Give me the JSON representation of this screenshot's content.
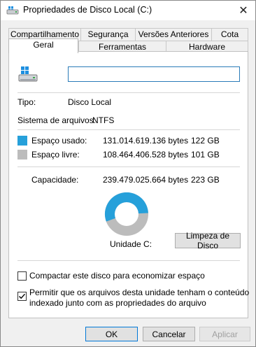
{
  "window": {
    "title": "Propriedades de Disco Local (C:)",
    "close_symbol": "✕"
  },
  "tabs_row1": [
    "Compartilhamento",
    "Segurança",
    "Versões Anteriores",
    "Cota"
  ],
  "tabs_row2": [
    "Geral",
    "Ferramentas",
    "Hardware"
  ],
  "active_tab": "Geral",
  "general": {
    "drive_icon": "drive-icon",
    "name_value": "",
    "type_label": "Tipo:",
    "type_value": "Disco Local",
    "fs_label": "Sistema de arquivos:",
    "fs_value": "NTFS",
    "used_label": "Espaço usado:",
    "used_bytes": "131.014.619.136 bytes",
    "used_gb": "122 GB",
    "free_label": "Espaço livre:",
    "free_bytes": "108.464.406.528 bytes",
    "free_gb": "101 GB",
    "capacity_label": "Capacidade:",
    "capacity_bytes": "239.479.025.664 bytes",
    "capacity_gb": "223 GB",
    "used_fraction": 0.547,
    "unit_label": "Unidade C:",
    "cleanup_button": "Limpeza de Disco",
    "compress_label": "Compactar este disco para economizar espaço",
    "compress_checked": false,
    "index_label_line1": "Permitir que os arquivos desta unidade tenham o conteúdo",
    "index_label_line2": "indexado junto com as propriedades do arquivo",
    "index_checked": true
  },
  "colors": {
    "used": "#26a0da",
    "free": "#bcbcbc",
    "accent": "#0078d7"
  },
  "footer": {
    "ok": "OK",
    "cancel": "Cancelar",
    "apply": "Aplicar"
  }
}
